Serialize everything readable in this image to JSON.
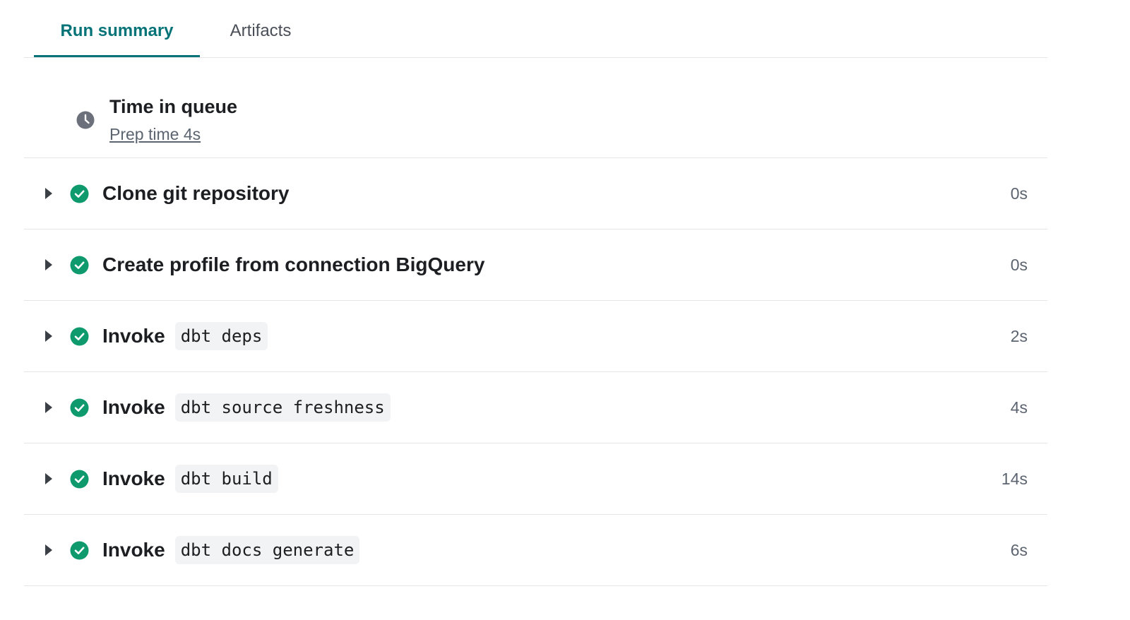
{
  "tabs": [
    {
      "label": "Run summary",
      "active": true
    },
    {
      "label": "Artifacts",
      "active": false
    }
  ],
  "queue": {
    "icon": "clock-icon",
    "title": "Time in queue",
    "prep_label": "Prep time 4s"
  },
  "steps": [
    {
      "title": "Clone git repository",
      "command": "",
      "duration": "0s",
      "status": "success"
    },
    {
      "title": "Create profile from connection BigQuery",
      "command": "",
      "duration": "0s",
      "status": "success"
    },
    {
      "title": "Invoke",
      "command": "dbt deps",
      "duration": "2s",
      "status": "success"
    },
    {
      "title": "Invoke",
      "command": "dbt source freshness",
      "duration": "4s",
      "status": "success"
    },
    {
      "title": "Invoke",
      "command": "dbt build",
      "duration": "14s",
      "status": "success"
    },
    {
      "title": "Invoke",
      "command": "dbt docs generate",
      "duration": "6s",
      "status": "success"
    }
  ],
  "colors": {
    "accent": "#047377",
    "success": "#0e9a6c",
    "icon_gray": "#6b707a",
    "caret": "#3b3f46"
  }
}
